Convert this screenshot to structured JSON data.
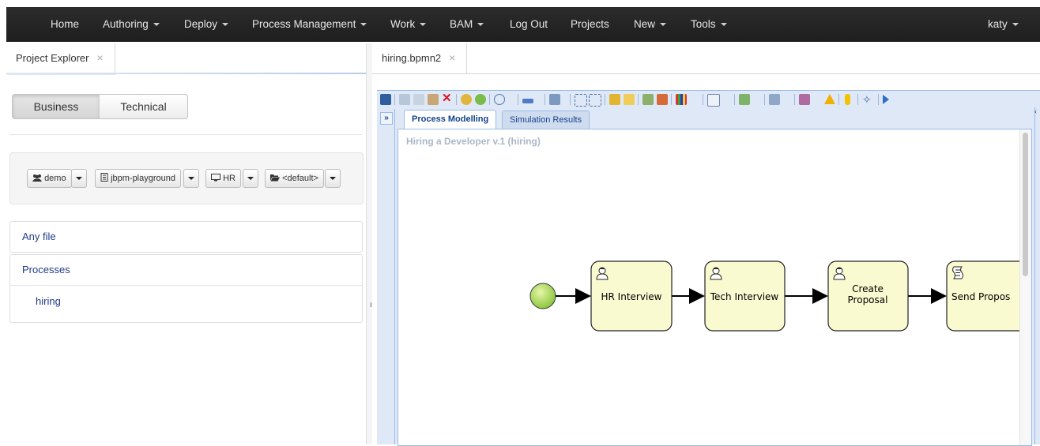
{
  "nav": {
    "items": [
      {
        "label": "Home",
        "caret": false
      },
      {
        "label": "Authoring",
        "caret": true
      },
      {
        "label": "Deploy",
        "caret": true
      },
      {
        "label": "Process Management",
        "caret": true
      },
      {
        "label": "Work",
        "caret": true
      },
      {
        "label": "BAM",
        "caret": true
      },
      {
        "label": "Log Out",
        "caret": false
      },
      {
        "label": "Projects",
        "caret": false
      },
      {
        "label": "New",
        "caret": true
      },
      {
        "label": "Tools",
        "caret": true
      }
    ],
    "user": "katy"
  },
  "left_panel": {
    "tab_label": "Project Explorer",
    "close_glyph": "×",
    "view_toggle": {
      "business": "Business",
      "technical": "Technical",
      "selected": "Business"
    },
    "selectors": [
      {
        "label": "demo",
        "icon": "group-icon"
      },
      {
        "label": "jbpm-playground",
        "icon": "repository-icon"
      },
      {
        "label": "HR",
        "icon": "monitor-icon"
      },
      {
        "label": "<default>",
        "icon": "folder-open-icon"
      }
    ],
    "sections": [
      {
        "label": "Any file"
      },
      {
        "label": "Processes",
        "items": [
          "hiring"
        ]
      }
    ]
  },
  "splitter": {
    "glyph": "॥"
  },
  "editor": {
    "tab_label": "hiring.bpmn2",
    "close_glyph": "×",
    "collapse_glyph": "»",
    "inner_tabs": {
      "active": "Process Modelling",
      "inactive": "Simulation Results"
    },
    "process_title": "Hiring a Developer v.1 (hiring)",
    "tasks": [
      {
        "label_lines": [
          "HR Interview"
        ],
        "type": "user-task"
      },
      {
        "label_lines": [
          "Tech Interview"
        ],
        "type": "user-task"
      },
      {
        "label_lines": [
          "Create",
          "Proposal"
        ],
        "type": "user-task"
      },
      {
        "label_lines": [
          "Send Propos"
        ],
        "type": "script-task"
      }
    ]
  },
  "colors": {
    "nav_bg": "#222222",
    "task_fill": "#fafad0",
    "start_event": "#9acd32",
    "link_blue": "#1f3a8a",
    "toolbar_bg": "#dfe8f6"
  }
}
